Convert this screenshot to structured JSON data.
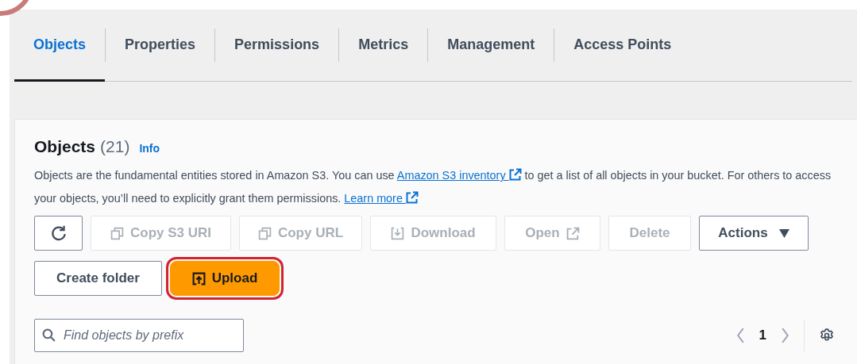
{
  "tabs": [
    {
      "label": "Objects",
      "selected": true
    },
    {
      "label": "Properties",
      "selected": false
    },
    {
      "label": "Permissions",
      "selected": false
    },
    {
      "label": "Metrics",
      "selected": false
    },
    {
      "label": "Management",
      "selected": false
    },
    {
      "label": "Access Points",
      "selected": false
    }
  ],
  "objects": {
    "title": "Objects",
    "count": "(21)",
    "info": "Info",
    "description_before": "Objects are the fundamental entities stored in Amazon S3. You can use",
    "inventory_link": "Amazon S3 inventory",
    "description_middle": "to get a list of all objects in your bucket. For others to access your objects, you’ll need to explicitly grant them permissions.",
    "learn_more_link": "Learn more"
  },
  "toolbar": [
    {
      "kind": "refresh",
      "disabled": false
    },
    {
      "kind": "copy",
      "label": "Copy S3 URI",
      "disabled": true
    },
    {
      "kind": "copy",
      "label": "Copy URL",
      "disabled": true
    },
    {
      "kind": "download",
      "label": "Download",
      "disabled": true
    },
    {
      "kind": "open",
      "label": "Open",
      "disabled": true
    },
    {
      "kind": "plain",
      "label": "Delete",
      "disabled": true
    },
    {
      "kind": "menu",
      "label": "Actions",
      "disabled": false
    }
  ],
  "actions": [
    {
      "kind": "plain",
      "label": "Create folder",
      "highlighted": false
    },
    {
      "kind": "upload",
      "label": "Upload",
      "highlighted": true
    }
  ],
  "search": {
    "placeholder": "Find objects by prefix"
  },
  "pagination": {
    "page": "1"
  }
}
